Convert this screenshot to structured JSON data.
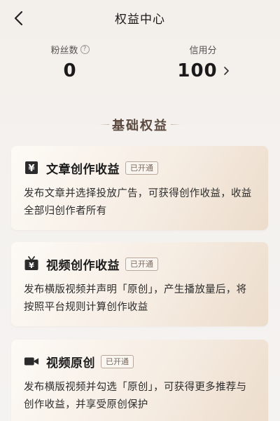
{
  "header": {
    "title": "权益中心"
  },
  "stats": {
    "fans": {
      "label": "粉丝数",
      "value": "0"
    },
    "credit": {
      "label": "信用分",
      "value": "100"
    }
  },
  "section": {
    "title": "基础权益"
  },
  "cards": [
    {
      "icon": "yen-icon",
      "title": "文章创作收益",
      "badge": "已开通",
      "desc": "发布文章并选择投放广告，可获得创作收益，收益全部归创作者所有"
    },
    {
      "icon": "tv-yen-icon",
      "title": "视频创作收益",
      "badge": "已开通",
      "desc": "发布横版视频并声明「原创」，产生播放量后，将按照平台规则计算创作收益"
    },
    {
      "icon": "video-camera-icon",
      "title": "视频原创",
      "badge": "已开通",
      "desc": "发布横版视频并勾选「原创」，可获得更多推荐与创作收益，并享受原创保护"
    }
  ]
}
